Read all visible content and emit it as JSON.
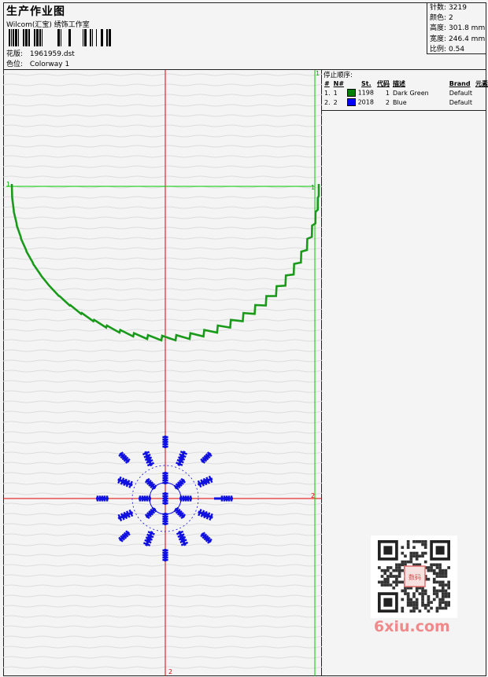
{
  "header": {
    "title": "生产作业图",
    "company": "Wilcom(汇宝) 绣饰工作室",
    "file_label": "花版:",
    "file_value": "1961959.dst",
    "colorway_label": "色位:",
    "colorway_value": "Colorway 1"
  },
  "stats": [
    {
      "label": "针数:",
      "value": "3219"
    },
    {
      "label": "颜色:",
      "value": "2"
    },
    {
      "label": "高度:",
      "value": "301.8 mm"
    },
    {
      "label": "宽度:",
      "value": "246.4 mm"
    },
    {
      "label": "比例:",
      "value": "0.54"
    }
  ],
  "stop_sequence": {
    "title": "停止顺序:",
    "headers": [
      "#",
      "N#",
      "St.",
      "代码",
      "描述",
      "Brand",
      "元素"
    ],
    "rows": [
      {
        "index": "1.",
        "n": "1",
        "color": "#008000",
        "st": "1198",
        "code": "1",
        "desc": "Dark Green",
        "brand": "Default"
      },
      {
        "index": "2.",
        "n": "2",
        "color": "#0000ff",
        "st": "2018",
        "code": "2",
        "desc": "Blue",
        "brand": "Default"
      }
    ]
  },
  "markers": {
    "green_top": "1",
    "green_left": "1",
    "green_right": "1",
    "red_right": "2",
    "red_bottom": "2"
  },
  "colors": {
    "green": "#1a9a1a",
    "blue": "#1010e0",
    "red": "#e00000",
    "guide_green": "#00cc00"
  },
  "watermark": {
    "text": "6xiu.com",
    "qr_center": "数码"
  }
}
